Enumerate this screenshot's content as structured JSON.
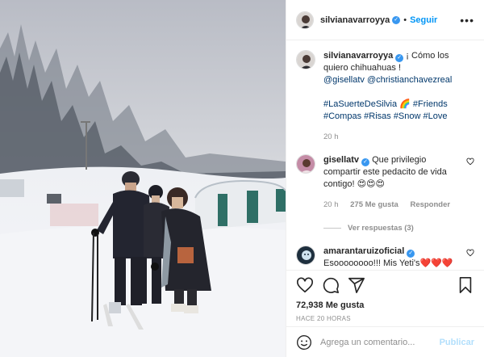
{
  "post": {
    "author": "silvianavarroyya",
    "follow_label": "Seguir",
    "more_label": "•••",
    "verified_mark": "✓"
  },
  "caption": {
    "text": "¡ Cómo los quiero chihuahuas !",
    "mentions": "@gisellatv @christianchavezreal",
    "hashtags_line1": "#LaSuerteDeSilvia 🌈 #Friends",
    "hashtags_line2": "#Compas #Risas #Snow #Love",
    "time": "20 h"
  },
  "comments": [
    {
      "user": "gisellatv",
      "text": "Que privilegio compartir este pedacito de vida contigo! 😍😍😍",
      "time": "20 h",
      "likes": "275 Me gusta",
      "reply_label": "Responder",
      "view_replies": "Ver respuestas (3)"
    },
    {
      "user": "amarantaruizoficial",
      "text": "Esoooooooo!!! Mis Yeti's❤️❤️❤️"
    }
  ],
  "stats": {
    "likes": "72,938 Me gusta",
    "posted_ago": "HACE 20 HORAS"
  },
  "composer": {
    "placeholder": "Agrega un comentario...",
    "publish_label": "Publicar"
  },
  "colors": {
    "accent": "#0095f6",
    "verified": "#3897f0",
    "mention": "#00376b",
    "muted": "#8e8e8e"
  },
  "icons": [
    "heart-icon",
    "comment-icon",
    "share-icon",
    "bookmark-icon",
    "emoji-icon",
    "more-icon"
  ]
}
